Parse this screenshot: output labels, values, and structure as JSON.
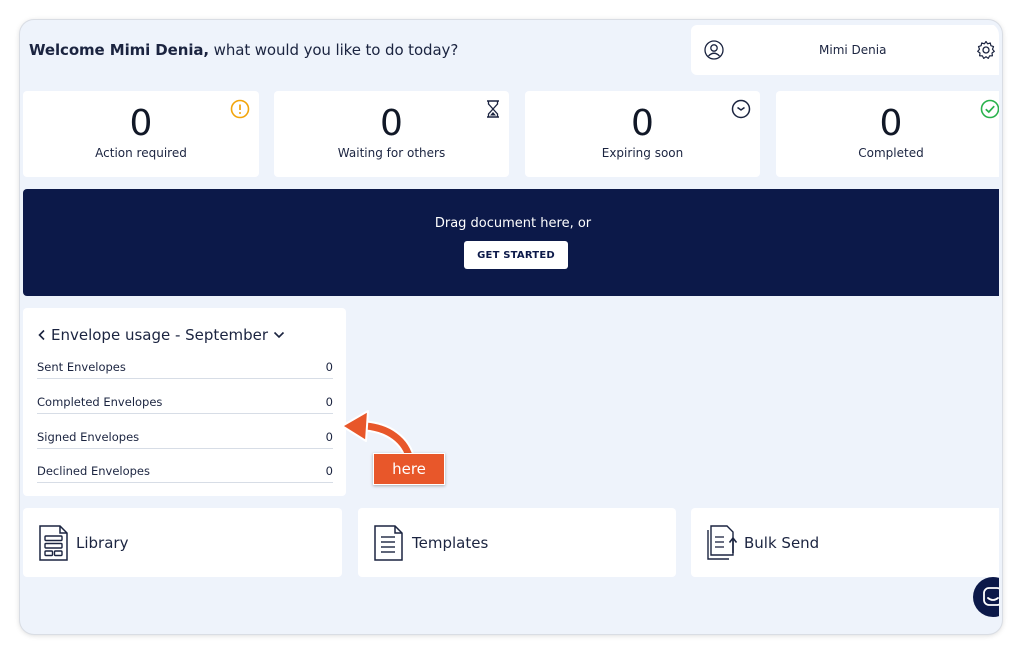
{
  "header": {
    "welcome_name": "Welcome Mimi Denia,",
    "welcome_rest": " what would you like to do today?",
    "user_name": "Mimi Denia"
  },
  "stats": [
    {
      "value": "0",
      "label": "Action required",
      "icon": "alert-circle-icon",
      "color": "#f2a50c"
    },
    {
      "value": "0",
      "label": "Waiting for others",
      "icon": "hourglass-icon",
      "color": "#1b2440"
    },
    {
      "value": "0",
      "label": "Expiring soon",
      "icon": "clock-icon",
      "color": "#1b2440"
    },
    {
      "value": "0",
      "label": "Completed",
      "icon": "check-circle-icon",
      "color": "#2ab24d"
    }
  ],
  "upload": {
    "text": "Drag document here, or",
    "button": "GET STARTED"
  },
  "usage": {
    "title": "Envelope usage - September",
    "rows": [
      {
        "label": "Sent Envelopes",
        "value": "0"
      },
      {
        "label": "Completed Envelopes",
        "value": "0"
      },
      {
        "label": "Signed Envelopes",
        "value": "0"
      },
      {
        "label": "Declined Envelopes",
        "value": "0"
      }
    ]
  },
  "tiles": [
    {
      "label": "Library",
      "icon": "library-icon"
    },
    {
      "label": "Templates",
      "icon": "templates-icon"
    },
    {
      "label": "Bulk Send",
      "icon": "bulk-send-icon"
    }
  ],
  "annotation": {
    "callout": "here"
  },
  "colors": {
    "navy": "#0c1949",
    "background": "#eef3fb",
    "callout": "#e8572a"
  }
}
